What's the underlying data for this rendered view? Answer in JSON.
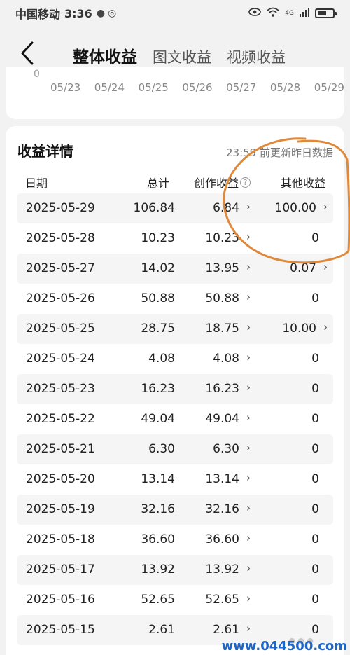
{
  "status_bar": {
    "carrier": "中国移动",
    "time": "3:36",
    "network": "4G"
  },
  "nav": {
    "tabs": [
      {
        "label": "整体收益",
        "active": true
      },
      {
        "label": "图文收益",
        "active": false
      },
      {
        "label": "视频收益",
        "active": false
      }
    ]
  },
  "chart_data": {
    "type": "line",
    "y_tick_labels": [
      "0"
    ],
    "x_tick_labels": [
      "05/23",
      "05/24",
      "05/25",
      "05/26",
      "05/27",
      "05/28",
      "05/29"
    ]
  },
  "details": {
    "title": "收益详情",
    "note": "23:59 前更新昨日数据",
    "columns": {
      "date": "日期",
      "total": "总计",
      "creation": "创作收益",
      "other": "其他收益"
    },
    "rows": [
      {
        "date": "2025-05-29",
        "total": "106.84",
        "creation": "6.84",
        "other": "100.00",
        "other_has_detail": true
      },
      {
        "date": "2025-05-28",
        "total": "10.23",
        "creation": "10.23",
        "other": "0",
        "other_has_detail": false
      },
      {
        "date": "2025-05-27",
        "total": "14.02",
        "creation": "13.95",
        "other": "0.07",
        "other_has_detail": true
      },
      {
        "date": "2025-05-26",
        "total": "50.88",
        "creation": "50.88",
        "other": "0",
        "other_has_detail": false
      },
      {
        "date": "2025-05-25",
        "total": "28.75",
        "creation": "18.75",
        "other": "10.00",
        "other_has_detail": true
      },
      {
        "date": "2025-05-24",
        "total": "4.08",
        "creation": "4.08",
        "other": "0",
        "other_has_detail": false
      },
      {
        "date": "2025-05-23",
        "total": "16.23",
        "creation": "16.23",
        "other": "0",
        "other_has_detail": false
      },
      {
        "date": "2025-05-22",
        "total": "49.04",
        "creation": "49.04",
        "other": "0",
        "other_has_detail": false
      },
      {
        "date": "2025-05-21",
        "total": "6.30",
        "creation": "6.30",
        "other": "0",
        "other_has_detail": false
      },
      {
        "date": "2025-05-20",
        "total": "13.14",
        "creation": "13.14",
        "other": "0",
        "other_has_detail": false
      },
      {
        "date": "2025-05-19",
        "total": "32.16",
        "creation": "32.16",
        "other": "0",
        "other_has_detail": false
      },
      {
        "date": "2025-05-18",
        "total": "36.60",
        "creation": "36.60",
        "other": "0",
        "other_has_detail": false
      },
      {
        "date": "2025-05-17",
        "total": "13.92",
        "creation": "13.92",
        "other": "0",
        "other_has_detail": false
      },
      {
        "date": "2025-05-16",
        "total": "52.65",
        "creation": "52.65",
        "other": "0",
        "other_has_detail": false
      },
      {
        "date": "2025-05-15",
        "total": "2.61",
        "creation": "2.61",
        "other": "0",
        "other_has_detail": false
      }
    ]
  },
  "watermark": {
    "text": "www.044500.com"
  },
  "colors": {
    "annotation": "#e0893a",
    "watermark": "#1e66c8",
    "row_stripe": "#f5f5f5"
  }
}
